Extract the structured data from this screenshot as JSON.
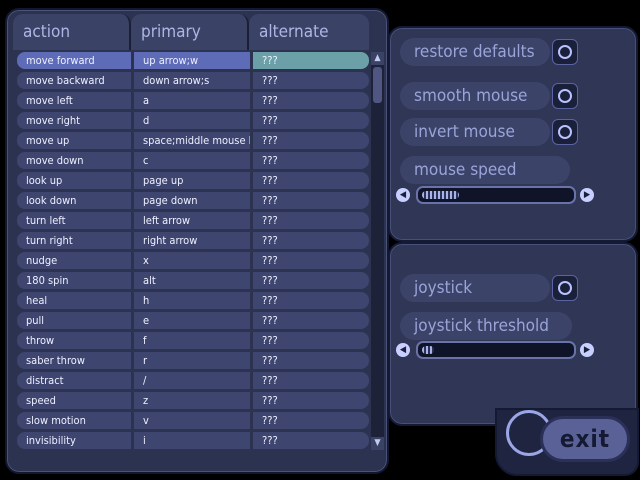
{
  "header": {
    "action": "action",
    "primary": "primary",
    "alternate": "alternate"
  },
  "bindings": [
    {
      "action": "move forward",
      "primary": "up arrow;w",
      "alternate": "???"
    },
    {
      "action": "move backward",
      "primary": "down arrow;s",
      "alternate": "???"
    },
    {
      "action": "move left",
      "primary": "a",
      "alternate": "???"
    },
    {
      "action": "move right",
      "primary": "d",
      "alternate": "???"
    },
    {
      "action": "move up",
      "primary": "space;middle mouse btn",
      "alternate": "???"
    },
    {
      "action": "move down",
      "primary": "c",
      "alternate": "???"
    },
    {
      "action": "look up",
      "primary": "page up",
      "alternate": "???"
    },
    {
      "action": "look down",
      "primary": "page down",
      "alternate": "???"
    },
    {
      "action": "turn left",
      "primary": "left arrow",
      "alternate": "???"
    },
    {
      "action": "turn right",
      "primary": "right arrow",
      "alternate": "???"
    },
    {
      "action": "nudge",
      "primary": "x",
      "alternate": "???"
    },
    {
      "action": "180 spin",
      "primary": "alt",
      "alternate": "???"
    },
    {
      "action": "heal",
      "primary": "h",
      "alternate": "???"
    },
    {
      "action": "pull",
      "primary": "e",
      "alternate": "???"
    },
    {
      "action": "throw",
      "primary": "f",
      "alternate": "???"
    },
    {
      "action": "saber throw",
      "primary": "r",
      "alternate": "???"
    },
    {
      "action": "distract",
      "primary": "/",
      "alternate": "???"
    },
    {
      "action": "speed",
      "primary": "z",
      "alternate": "???"
    },
    {
      "action": "slow motion",
      "primary": "v",
      "alternate": "???"
    },
    {
      "action": "invisibility",
      "primary": "i",
      "alternate": "???"
    }
  ],
  "selected_row": 0,
  "options": {
    "restore_defaults": "restore defaults",
    "smooth_mouse": "smooth mouse",
    "invert_mouse": "invert mouse",
    "mouse_speed": "mouse speed",
    "mouse_speed_level": 0.25,
    "joystick": "joystick",
    "joystick_threshold": "joystick threshold",
    "joystick_threshold_level": 0.08
  },
  "exit_label": "exit",
  "colors": {
    "panel": "#2c3350",
    "row": "#3e4670",
    "row_selected": "#5e6bb6",
    "alt_selected": "#6ba0a8",
    "label_text": "#9aa4d8"
  },
  "icons": {
    "scroll_up": "up-arrow",
    "scroll_down": "down-arrow",
    "slider_left": "left-arrow",
    "slider_right": "right-arrow"
  }
}
